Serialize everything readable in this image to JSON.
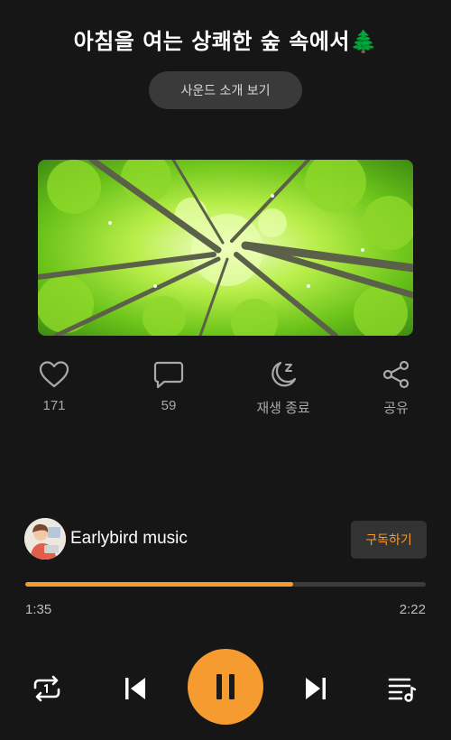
{
  "track": {
    "title": "아침을 여는 상쾌한 숲 속에서🌲",
    "intro_button": "사운드 소개 보기",
    "cover_alt": "forest canopy photo"
  },
  "actions": {
    "like": {
      "icon": "heart-icon",
      "label": "171"
    },
    "comment": {
      "icon": "chat-bubble-icon",
      "label": "59"
    },
    "sleep_timer": {
      "icon": "moon-icon",
      "label": "재생 종료"
    },
    "share": {
      "icon": "share-icon",
      "label": "공유"
    }
  },
  "channel": {
    "name": "Earlybird music",
    "subscribe_label": "구독하기"
  },
  "playback": {
    "current_time": "1:35",
    "total_time": "2:22",
    "progress": 0.67
  },
  "colors": {
    "accent": "#f59b2f",
    "background": "#161616"
  },
  "controls": {
    "repeat": "repeat-icon",
    "previous": "skip-previous-icon",
    "pause": "pause-icon",
    "next": "skip-next-icon",
    "playlist": "playlist-icon"
  }
}
